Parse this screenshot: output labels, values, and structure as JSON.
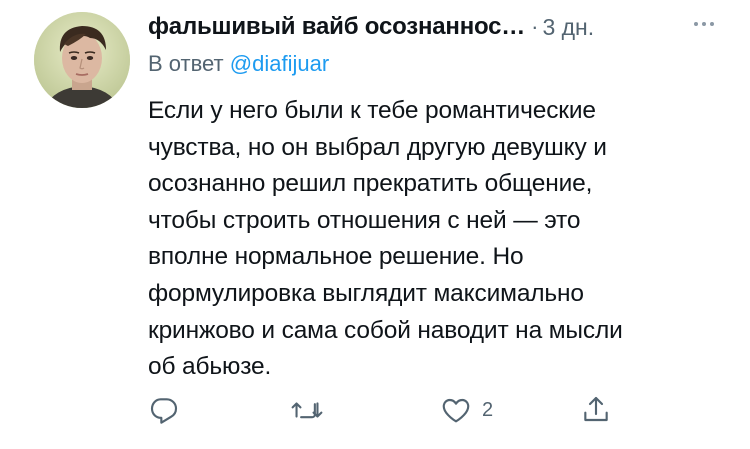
{
  "tweet": {
    "display_name": "фальшивый вайб осознаннос…",
    "separator": "·",
    "time": "3 дн.",
    "reply_prefix": "В ответ",
    "reply_handle": "@diafijuar",
    "text_lines": [
      "Если у него были к тебе романтические",
      "чувства, но он выбрал другую девушку и",
      "осознанно решил прекратить общение,",
      "чтобы строить отношения с ней — это",
      "вполне нормальное решение. Но",
      "формулировка выглядит максимально",
      "кринжово и сама собой наводит на мысли",
      "об абьюзе."
    ]
  },
  "actions": {
    "reply": {
      "icon": "reply-icon",
      "count": ""
    },
    "retweet": {
      "icon": "retweet-icon",
      "count": ""
    },
    "like": {
      "icon": "heart-icon",
      "count": "2"
    },
    "share": {
      "icon": "share-icon",
      "count": ""
    }
  },
  "colors": {
    "text": "#0f1419",
    "secondary": "#536471",
    "link": "#1d9bf0",
    "background": "#ffffff"
  }
}
